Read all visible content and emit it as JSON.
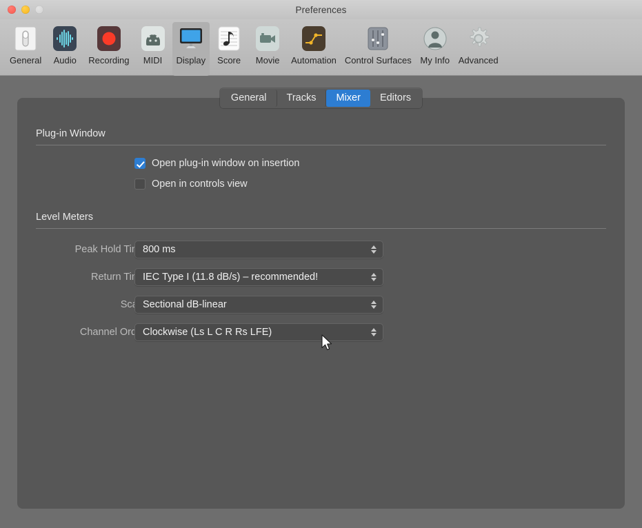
{
  "window": {
    "title": "Preferences",
    "traffic_lights": [
      {
        "name": "close",
        "color": "#f9584e"
      },
      {
        "name": "minimize",
        "color": "#f8b51c"
      },
      {
        "name": "zoom",
        "color": "#d2d2d2"
      }
    ]
  },
  "toolbar": {
    "items": [
      {
        "label": "General",
        "icon": "toggle-switch-icon",
        "selected": false
      },
      {
        "label": "Audio",
        "icon": "waveform-icon",
        "selected": false
      },
      {
        "label": "Recording",
        "icon": "record-circle-icon",
        "selected": false
      },
      {
        "label": "MIDI",
        "icon": "midi-din-icon",
        "selected": false
      },
      {
        "label": "Display",
        "icon": "monitor-icon",
        "selected": true
      },
      {
        "label": "Score",
        "icon": "music-note-icon",
        "selected": false
      },
      {
        "label": "Movie",
        "icon": "video-camera-icon",
        "selected": false
      },
      {
        "label": "Automation",
        "icon": "automation-curve-icon",
        "selected": false
      },
      {
        "label": "Control Surfaces",
        "icon": "faders-icon",
        "selected": false
      },
      {
        "label": "My Info",
        "icon": "person-icon",
        "selected": false
      },
      {
        "label": "Advanced",
        "icon": "gear-icon",
        "selected": false
      }
    ]
  },
  "tabs": {
    "items": [
      {
        "label": "General",
        "active": false
      },
      {
        "label": "Tracks",
        "active": false
      },
      {
        "label": "Mixer",
        "active": true
      },
      {
        "label": "Editors",
        "active": false
      }
    ],
    "active_color": "#2d7dd2"
  },
  "sections": [
    {
      "title": "Plug-in Window",
      "checkboxes": [
        {
          "label": "Open plug-in window on insertion",
          "checked": true
        },
        {
          "label": "Open in controls view",
          "checked": false
        }
      ]
    },
    {
      "title": "Level Meters",
      "fields": [
        {
          "label": "Peak Hold Time:",
          "value": "800 ms"
        },
        {
          "label": "Return Time:",
          "value": "IEC Type I (11.8 dB/s) – recommended!"
        },
        {
          "label": "Scale:",
          "value": "Sectional dB-linear"
        },
        {
          "label": "Channel Order:",
          "value": "Clockwise (Ls L C R Rs LFE)"
        }
      ]
    }
  ],
  "colors": {
    "accent": "#2d7dd2",
    "panel_bg": "#575757",
    "window_bg": "#6e6e6e",
    "toolbar_bg": "#bdbdbd"
  }
}
